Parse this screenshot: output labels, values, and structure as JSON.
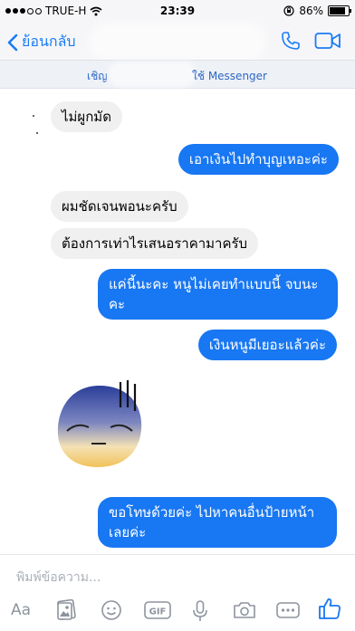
{
  "status_bar": {
    "carrier": "TRUE-H",
    "time": "23:39",
    "battery": "86%",
    "battery_level": 0.86,
    "signal_bars": 3
  },
  "nav": {
    "back_label": "ย้อนกลับ"
  },
  "invite": {
    "prefix": "เชิญ",
    "suffix": "ใช้ Messenger"
  },
  "messages": [
    {
      "side": "in",
      "text": "ไม่ผูกมัด"
    },
    {
      "side": "out",
      "text": "เอาเงินไปทำบุญเหอะค่ะ"
    },
    {
      "side": "in",
      "text": "ผมชัดเจนพอนะครับ"
    },
    {
      "side": "in",
      "text": "ต้องการเท่าไรเสนอราคามาครับ"
    },
    {
      "side": "out",
      "lines": [
        "แค่นี้นะคะ หนูไม่เคยทำแบบนี้ จบนะ",
        "คะ"
      ]
    },
    {
      "side": "out",
      "text": "เงินหนูมีเยอะแล้วค่ะ"
    },
    {
      "side": "out",
      "lines": [
        "ขอโทษด้วยค่ะ ไปหาคนอื่นป้ายหน้า",
        "เลยค่ะ"
      ]
    }
  ],
  "composer": {
    "placeholder": "พิมพ์ข้อความ...",
    "aa_label": "Aa",
    "gif_label": "GIF"
  },
  "icons": [
    "chevron-left-icon",
    "phone-icon",
    "video-camera-icon",
    "wifi-icon",
    "lock-rotation-icon",
    "gallery-icon",
    "emoji-icon",
    "gif-icon",
    "microphone-icon",
    "camera-icon",
    "more-icon",
    "like-icon",
    "sad-face-sticker"
  ],
  "colors": {
    "accent": "#1877f2",
    "incoming_bubble": "#f0f0f0",
    "link": "#1a7cf5"
  }
}
